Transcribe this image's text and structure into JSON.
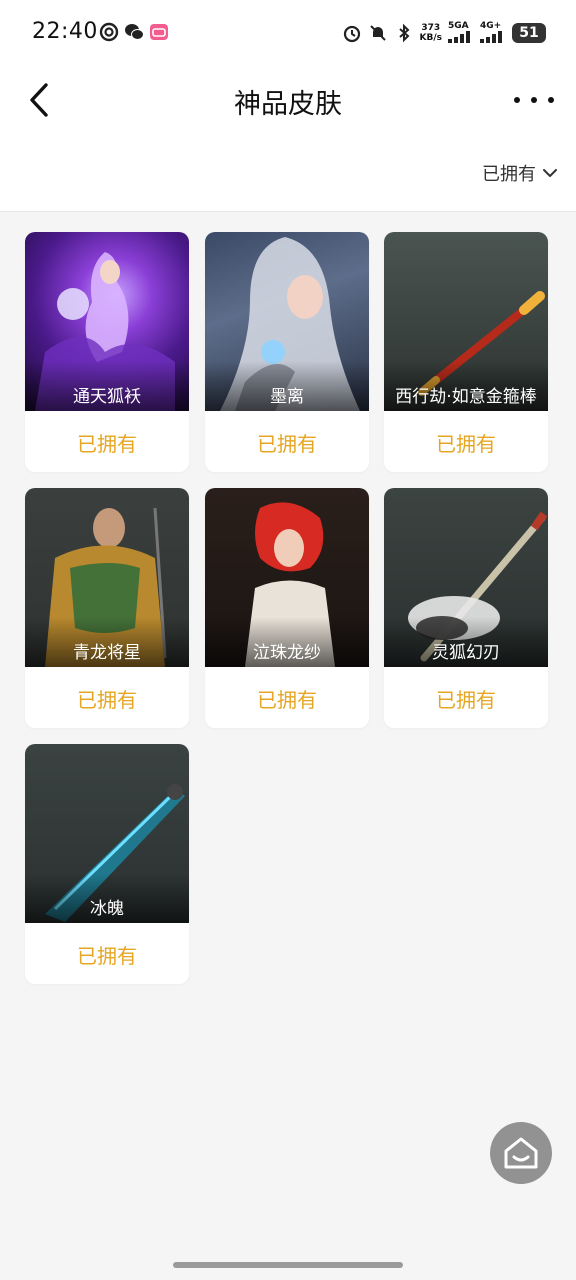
{
  "status_bar": {
    "time": "22:40",
    "net_speed_value": "373",
    "net_speed_unit": "KB/s",
    "sim1_label": "5GA",
    "sim2_label": "4G+",
    "battery": "51"
  },
  "nav": {
    "title": "神品皮肤",
    "back_icon": "chevron-left-icon",
    "more_icon": "more-dots-icon"
  },
  "filter": {
    "selected": "已拥有"
  },
  "skins": [
    {
      "name": "通天狐袄",
      "status": "已拥有"
    },
    {
      "name": "墨离",
      "status": "已拥有"
    },
    {
      "name": "西行劫·如意金箍棒",
      "status": "已拥有"
    },
    {
      "name": "青龙将星",
      "status": "已拥有"
    },
    {
      "name": "泣珠龙纱",
      "status": "已拥有"
    },
    {
      "name": "灵狐幻刃",
      "status": "已拥有"
    },
    {
      "name": "冰魄",
      "status": "已拥有"
    }
  ],
  "colors": {
    "accent_owned": "#e6a623",
    "background": "#f5f5f5"
  }
}
